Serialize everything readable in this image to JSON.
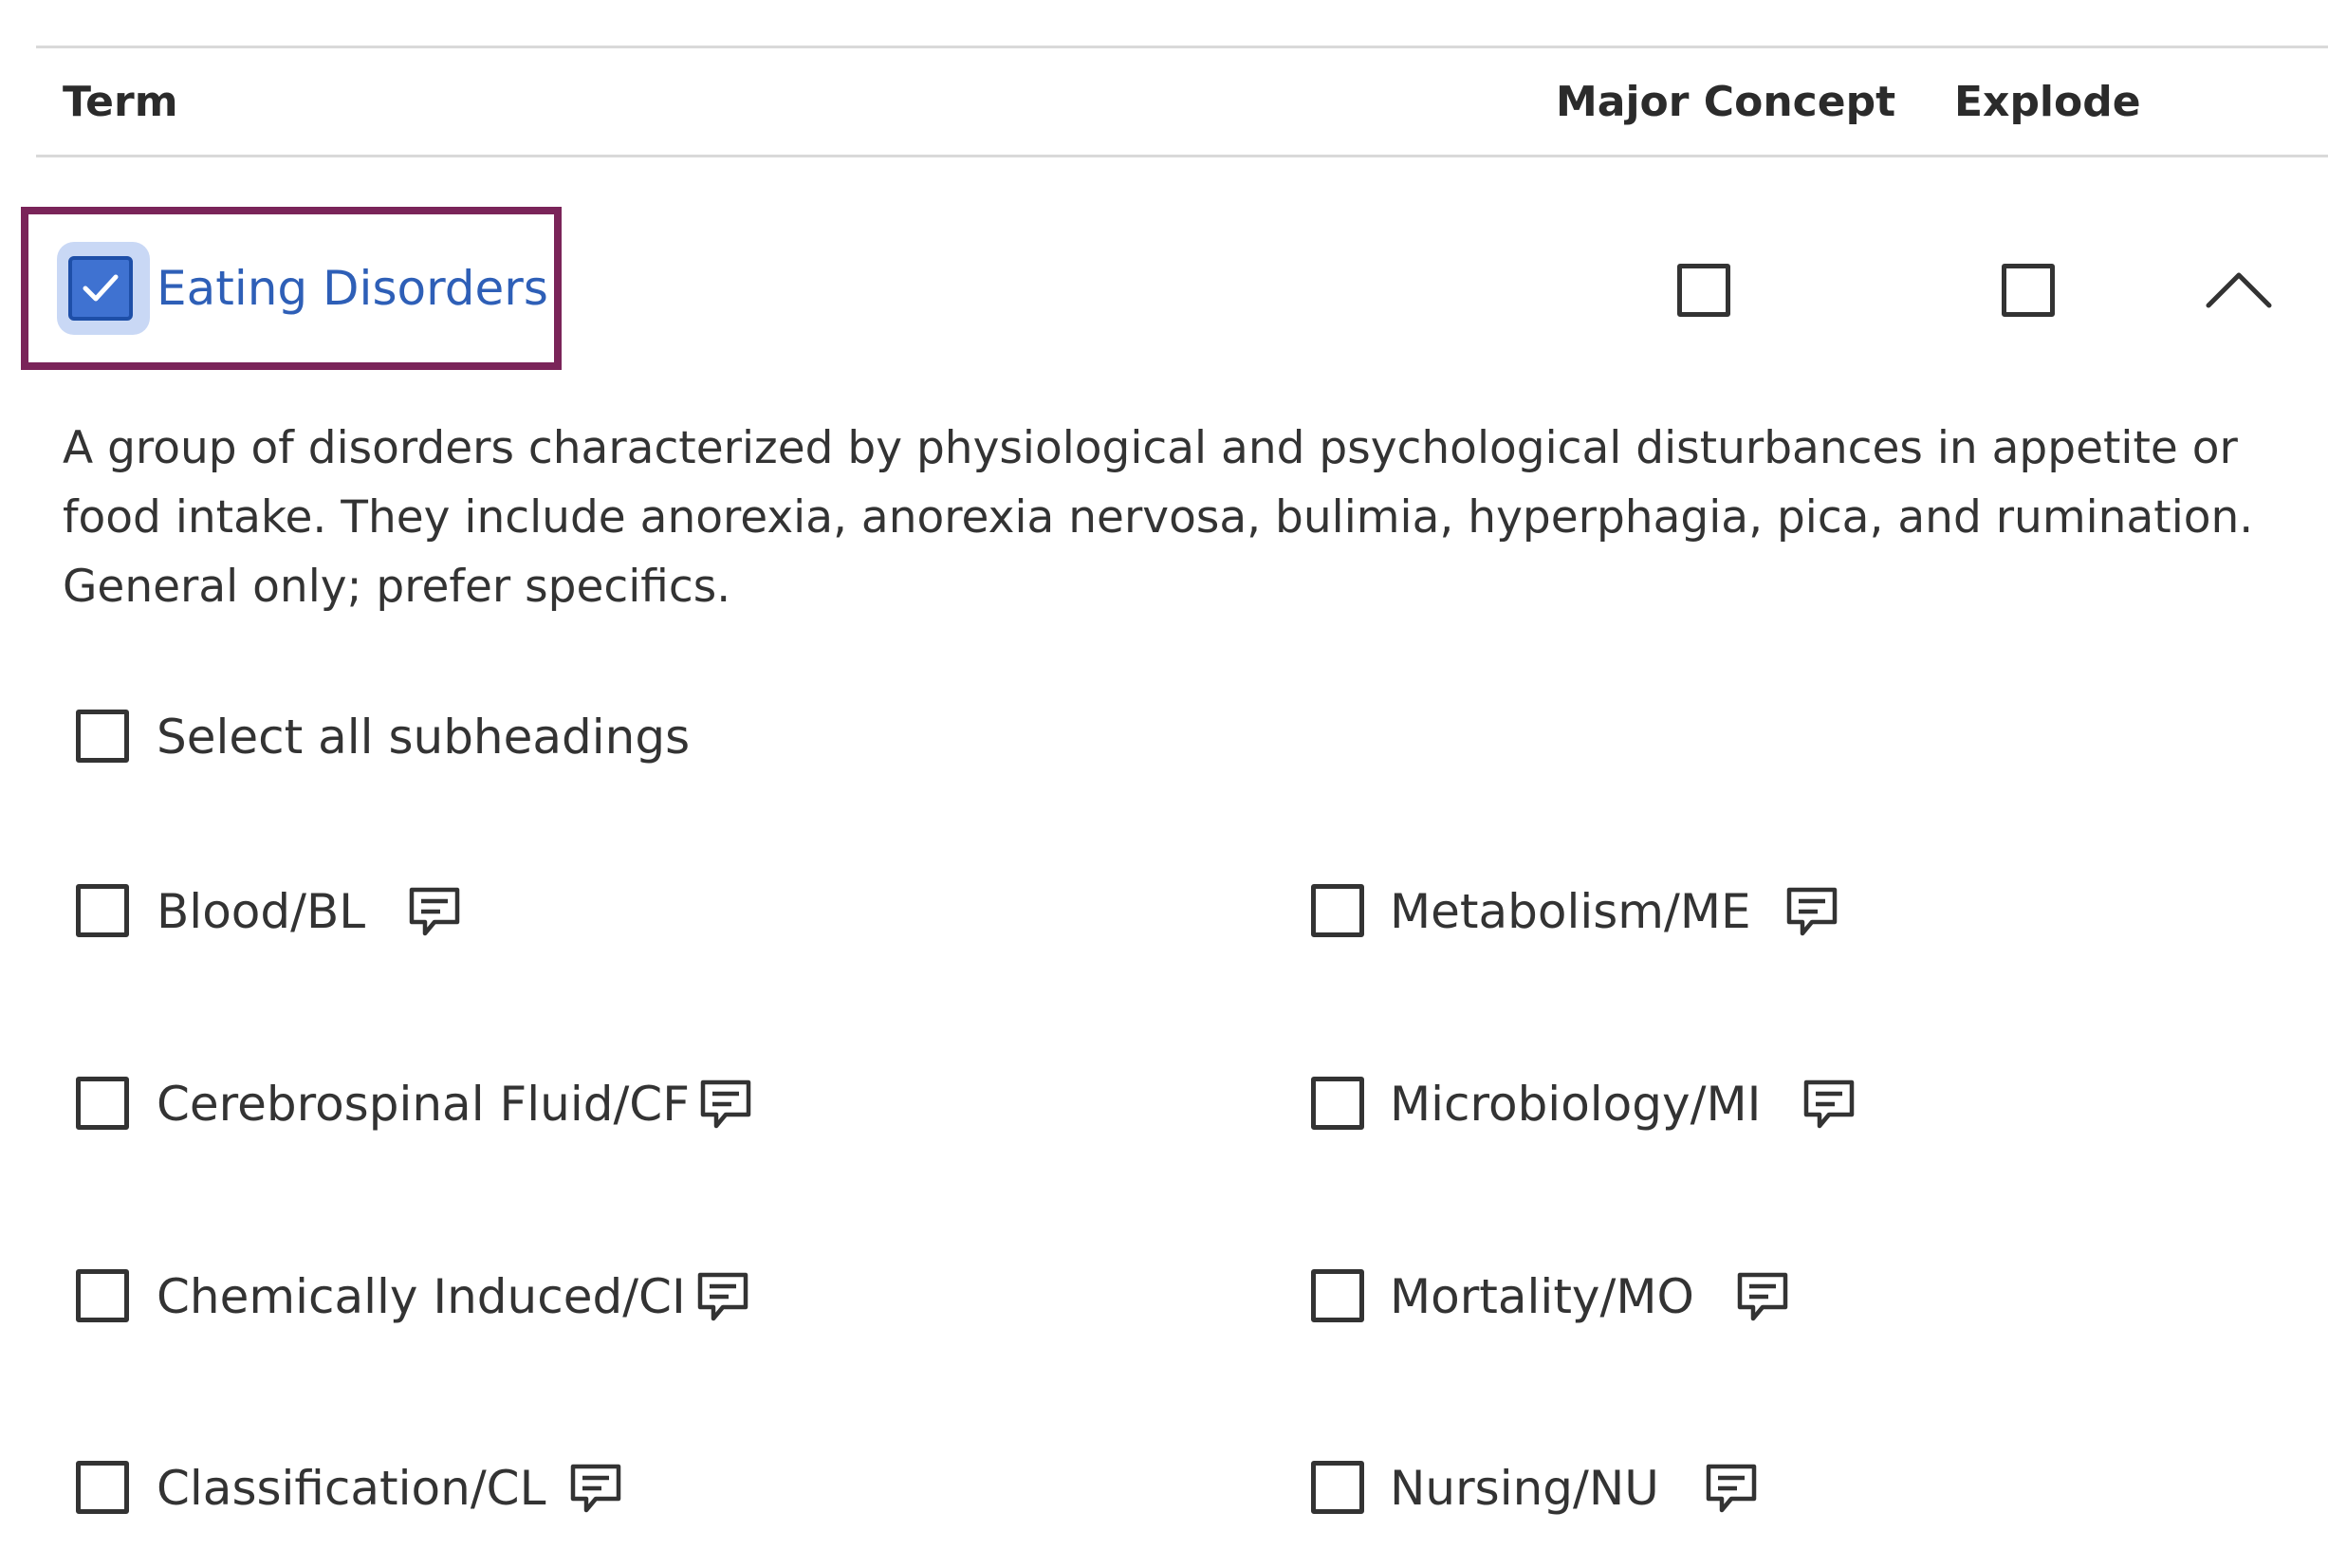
{
  "header": {
    "term_label": "Term",
    "major_concept_label": "Major Concept",
    "explode_label": "Explode"
  },
  "term": {
    "name": "Eating Disorders",
    "checked": true,
    "major_concept_checked": false,
    "explode_checked": false,
    "expanded": true,
    "description": "A group of disorders characterized by physiological and psychological disturbances in appetite or food intake. They include anorexia, anorexia nervosa, bulimia, hyperphagia, pica, and rumination. General only; prefer specifics."
  },
  "select_all": {
    "label": "Select all subheadings",
    "checked": false
  },
  "subheadings": [
    {
      "label": "Blood/BL",
      "checked": false
    },
    {
      "label": "Metabolism/ME",
      "checked": false
    },
    {
      "label": "Cerebrospinal Fluid/CF",
      "checked": false
    },
    {
      "label": "Microbiology/MI",
      "checked": false
    },
    {
      "label": "Chemically Induced/CI",
      "checked": false
    },
    {
      "label": "Mortality/MO",
      "checked": false
    },
    {
      "label": "Classification/CL",
      "checked": false
    },
    {
      "label": "Nursing/NU",
      "checked": false
    }
  ],
  "icons": {
    "checkmark": "check-icon",
    "collapse": "chevron-up-icon",
    "scope_note": "comment-icon"
  },
  "colors": {
    "highlight_border": "#7a2459",
    "link": "#2e5fb7",
    "checkbox_checked": "#3f72d1",
    "focus_ring": "#c9d8f5"
  }
}
